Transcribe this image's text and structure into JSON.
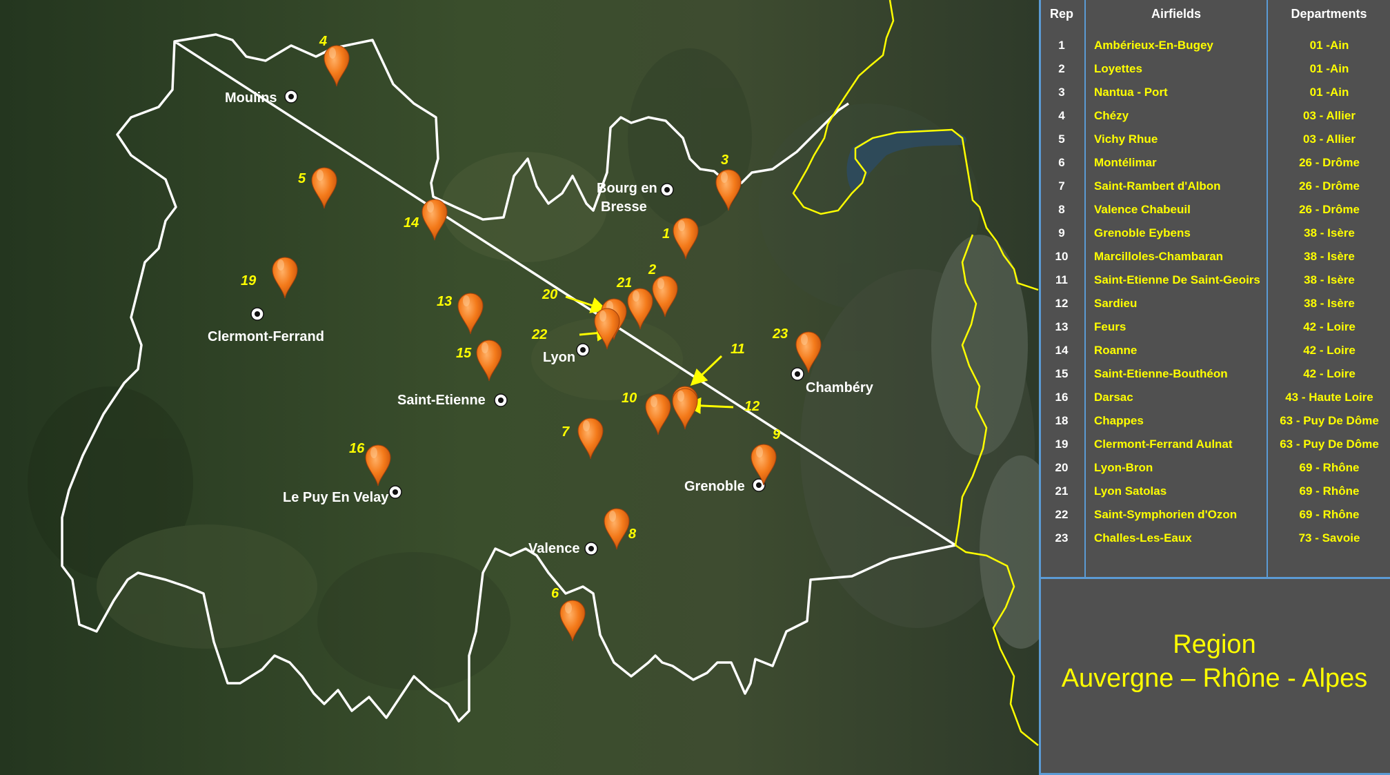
{
  "colors": {
    "boundary": "#ffffff",
    "border_country": "#ffff00",
    "marker": "#f47a1a",
    "marker_dark": "#c4500a",
    "marker_number": "#ffff00",
    "panel_bg": "#505050",
    "table_lines": "#5b9bd5",
    "region_text": "#ffff00"
  },
  "map": {
    "cities": [
      {
        "id": "moulins",
        "label": "Moulins"
      },
      {
        "id": "bourg",
        "label": "Bourg en Bresse"
      },
      {
        "id": "clermont",
        "label": "Clermont-Ferrand"
      },
      {
        "id": "lyon",
        "label": "Lyon"
      },
      {
        "id": "saint-etienne",
        "label": "Saint-Etienne"
      },
      {
        "id": "chambery",
        "label": "Chambéry"
      },
      {
        "id": "grenoble",
        "label": "Grenoble"
      },
      {
        "id": "le-puy",
        "label": "Le Puy En Velay"
      },
      {
        "id": "valence",
        "label": "Valence"
      }
    ],
    "markers": [
      "4",
      "5",
      "14",
      "19",
      "3",
      "1",
      "2",
      "21",
      "20",
      "22",
      "13",
      "15",
      "23",
      "11",
      "10",
      "12",
      "7",
      "9",
      "16",
      "8",
      "6"
    ]
  },
  "table": {
    "headers": {
      "rep": "Rep",
      "airfields": "Airfields",
      "departments": "Departments"
    },
    "rows": [
      {
        "rep": "1",
        "airfield": "Ambérieux-En-Bugey",
        "department": "01 -Ain"
      },
      {
        "rep": "2",
        "airfield": "Loyettes",
        "department": "01 -Ain"
      },
      {
        "rep": "3",
        "airfield": "Nantua - Port",
        "department": "01 -Ain"
      },
      {
        "rep": "4",
        "airfield": "Chézy",
        "department": "03 - Allier"
      },
      {
        "rep": "5",
        "airfield": "Vichy Rhue",
        "department": "03 - Allier"
      },
      {
        "rep": "6",
        "airfield": "Montélimar",
        "department": "26 - Drôme"
      },
      {
        "rep": "7",
        "airfield": "Saint-Rambert d'Albon",
        "department": "26 - Drôme"
      },
      {
        "rep": "8",
        "airfield": "Valence Chabeuil",
        "department": "26 - Drôme"
      },
      {
        "rep": "9",
        "airfield": "Grenoble Eybens",
        "department": "38 - Isère"
      },
      {
        "rep": "10",
        "airfield": "Marcilloles-Chambaran",
        "department": "38 - Isère"
      },
      {
        "rep": "11",
        "airfield": "Saint-Etienne De Saint-Geoirs",
        "department": "38 - Isère"
      },
      {
        "rep": "12",
        "airfield": "Sardieu",
        "department": "38 - Isère"
      },
      {
        "rep": "13",
        "airfield": "Feurs",
        "department": "42 - Loire"
      },
      {
        "rep": "14",
        "airfield": "Roanne",
        "department": "42 - Loire"
      },
      {
        "rep": "15",
        "airfield": "Saint-Etienne-Bouthéon",
        "department": "42 - Loire"
      },
      {
        "rep": "16",
        "airfield": "Darsac",
        "department": "43 - Haute Loire"
      },
      {
        "rep": "18",
        "airfield": "Chappes",
        "department": "63 - Puy De Dôme"
      },
      {
        "rep": "19",
        "airfield": "Clermont-Ferrand Aulnat",
        "department": "63 - Puy De Dôme"
      },
      {
        "rep": "20",
        "airfield": "Lyon-Bron",
        "department": "69 - Rhône"
      },
      {
        "rep": "21",
        "airfield": "Lyon Satolas",
        "department": "69 - Rhône"
      },
      {
        "rep": "22",
        "airfield": "Saint-Symphorien d'Ozon",
        "department": "69 - Rhône"
      },
      {
        "rep": "23",
        "airfield": "Challes-Les-Eaux",
        "department": "73 - Savoie"
      }
    ]
  },
  "region": {
    "line1": "Region",
    "line2": "Auvergne – Rhône - Alpes"
  }
}
